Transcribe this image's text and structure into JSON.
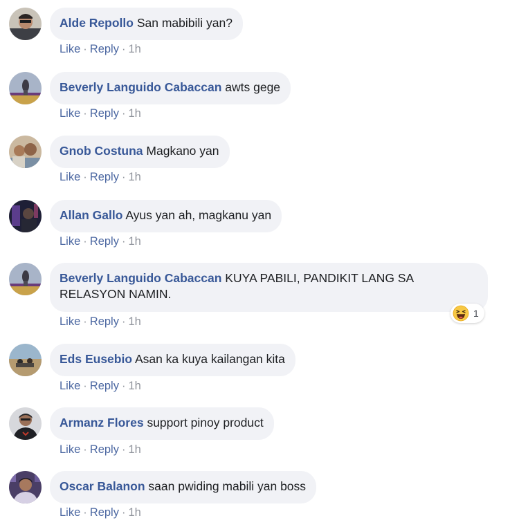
{
  "comments": [
    {
      "name": "Alde Repollo",
      "text": "San mabibili yan?",
      "like": "Like",
      "reply": "Reply",
      "time": "1h"
    },
    {
      "name": "Beverly Languido Cabaccan",
      "text": "awts gege",
      "like": "Like",
      "reply": "Reply",
      "time": "1h"
    },
    {
      "name": "Gnob Costuna",
      "text": "Magkano yan",
      "like": "Like",
      "reply": "Reply",
      "time": "1h"
    },
    {
      "name": "Allan Gallo",
      "text": "Ayus yan ah, magkanu yan",
      "like": "Like",
      "reply": "Reply",
      "time": "1h"
    },
    {
      "name": "Beverly Languido Cabaccan",
      "text": "KUYA PABILI, PANDIKIT LANG SA RELASYON NAMIN.",
      "like": "Like",
      "reply": "Reply",
      "time": "1h",
      "reaction": {
        "icon": "haha-emoji-icon",
        "count": "1"
      }
    },
    {
      "name": "Eds Eusebio",
      "text": "Asan ka kuya kailangan kita",
      "like": "Like",
      "reply": "Reply",
      "time": "1h"
    },
    {
      "name": "Armanz Flores",
      "text": "support pinoy product",
      "like": "Like",
      "reply": "Reply",
      "time": "1h"
    },
    {
      "name": "Oscar Balanon",
      "text": "saan pwiding mabili yan boss",
      "like": "Like",
      "reply": "Reply",
      "time": "1h"
    }
  ],
  "colors": {
    "bubble_bg": "#f1f2f6",
    "name": "#385898",
    "action_link": "#4b67a1",
    "timestamp": "#90949c"
  }
}
